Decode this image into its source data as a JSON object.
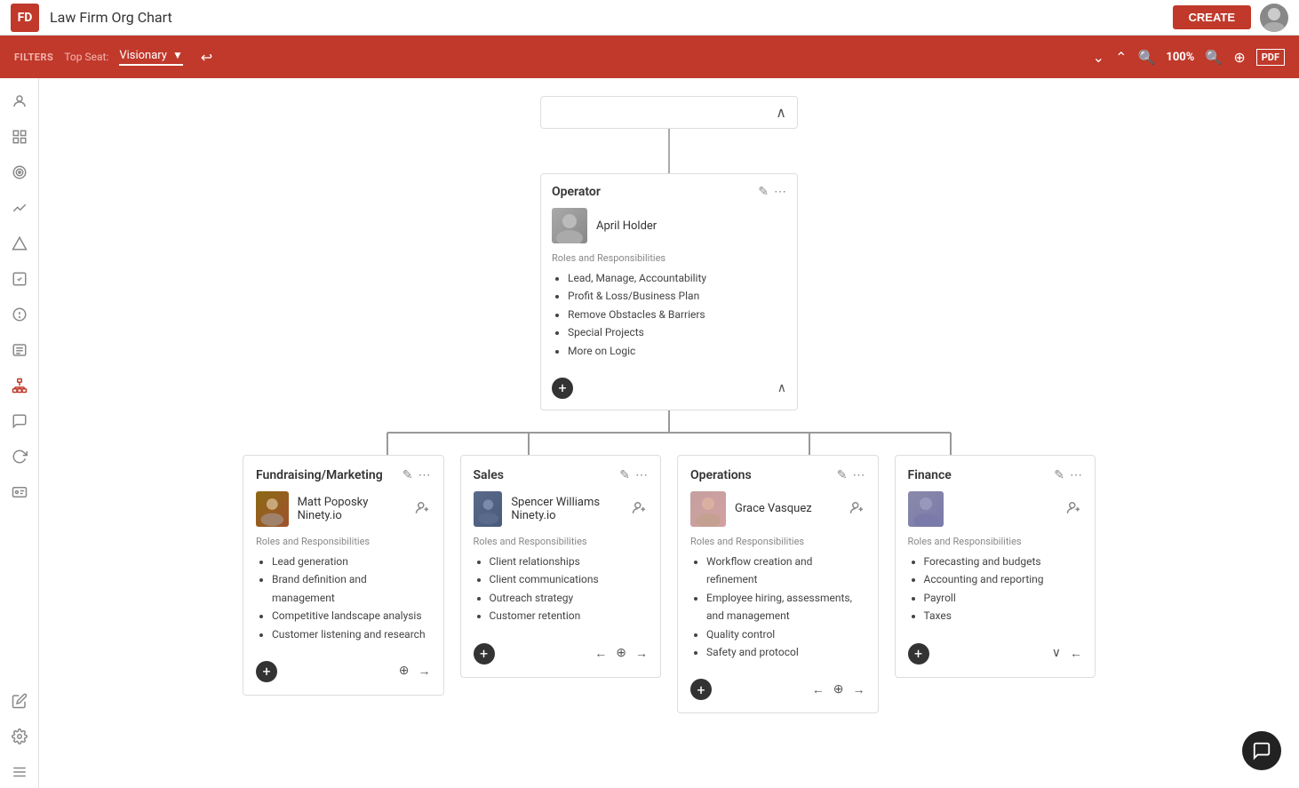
{
  "app": {
    "logo": "FD",
    "title": "Law Firm Org Chart",
    "create_label": "CREATE"
  },
  "filters": {
    "label": "FILTERS",
    "top_seat_label": "Top Seat:",
    "top_seat_value": "Visionary",
    "zoom": "100%"
  },
  "sidebar": {
    "items": [
      {
        "name": "people-icon",
        "symbol": "👤"
      },
      {
        "name": "grid-icon",
        "symbol": "▦"
      },
      {
        "name": "target-icon",
        "symbol": "◎"
      },
      {
        "name": "chart-icon",
        "symbol": "∿"
      },
      {
        "name": "mountain-icon",
        "symbol": "⛰"
      },
      {
        "name": "check-icon",
        "symbol": "☑"
      },
      {
        "name": "alert-icon",
        "symbol": "!"
      },
      {
        "name": "list-icon",
        "symbol": "☰"
      },
      {
        "name": "org-icon",
        "symbol": "⚙"
      },
      {
        "name": "chat-icon",
        "symbol": "💬"
      },
      {
        "name": "refresh-icon",
        "symbol": "↺"
      },
      {
        "name": "id-icon",
        "symbol": "🪪"
      }
    ],
    "bottom_items": [
      {
        "name": "edit-icon",
        "symbol": "✎"
      },
      {
        "name": "settings-icon",
        "symbol": "⚙"
      },
      {
        "name": "menu-icon",
        "symbol": "≡"
      }
    ]
  },
  "operator_card": {
    "title": "Operator",
    "person_name": "April Holder",
    "roles_title": "Roles and Responsibilities",
    "roles": [
      "Lead, Manage, Accountability",
      "Profit & Loss/Business Plan",
      "Remove Obstacles & Barriers",
      "Special Projects",
      "More on Logic"
    ]
  },
  "partial_top_card": {
    "has_chevron": true
  },
  "bottom_cards": [
    {
      "id": "fundraising",
      "title": "Fundraising/Marketing",
      "person_name": "Matt Poposky Ninety.io",
      "roles_title": "Roles and Responsibilities",
      "roles": [
        "Lead generation",
        "Brand definition and management",
        "Competitive landscape analysis",
        "Customer listening and research"
      ]
    },
    {
      "id": "sales",
      "title": "Sales",
      "person_name": "Spencer Williams Ninety.io",
      "roles_title": "Roles and Responsibilities",
      "roles": [
        "Client relationships",
        "Client communications",
        "Outreach strategy",
        "Customer retention"
      ]
    },
    {
      "id": "operations",
      "title": "Operations",
      "person_name": "Grace Vasquez",
      "roles_title": "Roles and Responsibilities",
      "roles": [
        "Workflow creation and refinement",
        "Employee hiring, assessments, and management",
        "Quality control",
        "Safety and protocol"
      ]
    },
    {
      "id": "finance",
      "title": "Finance",
      "person_name": "",
      "roles_title": "Roles and Responsibilities",
      "roles": [
        "Forecasting and budgets",
        "Accounting and reporting",
        "Payroll",
        "Taxes"
      ]
    }
  ]
}
